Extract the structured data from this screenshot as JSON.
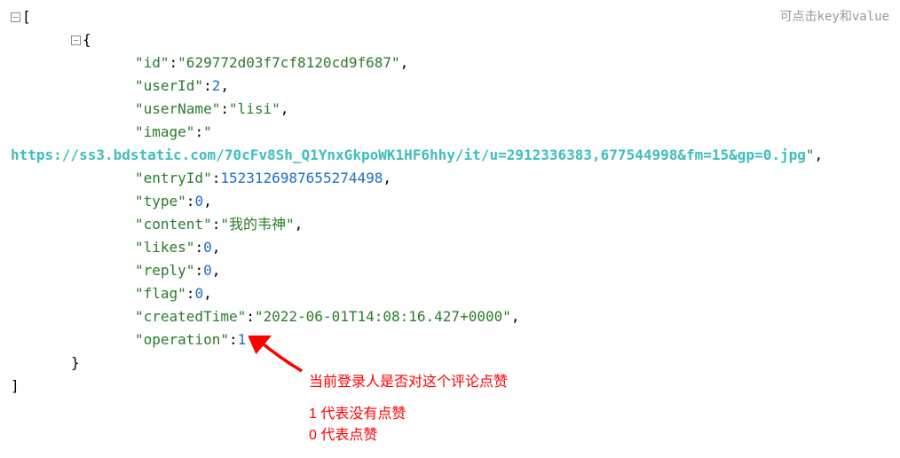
{
  "hint": "可点击key和value",
  "json": {
    "keys": {
      "id": "\"id\"",
      "userId": "\"userId\"",
      "userName": "\"userName\"",
      "image": "\"image\"",
      "entryId": "\"entryId\"",
      "type": "\"type\"",
      "content": "\"content\"",
      "likes": "\"likes\"",
      "reply": "\"reply\"",
      "flag": "\"flag\"",
      "createdTime": "\"createdTime\"",
      "operation": "\"operation\""
    },
    "values": {
      "id": "\"629772d03f7cf8120cd9f687\"",
      "userId": "2",
      "userName": "\"lisi\"",
      "image_prefixQuote": "\"",
      "image_url": "https://ss3.bdstatic.com/70cFv8Sh_Q1YnxGkpoWK1HF6hhy/it/u=2912336383,677544998&fm=15&gp=0.jpg",
      "image_suffixQuote": "\"",
      "entryId": "1523126987655274498",
      "type": "0",
      "content": "\"我的韦神\"",
      "likes": "0",
      "reply": "0",
      "flag": "0",
      "createdTime": "\"2022-06-01T14:08:16.427+0000\"",
      "operation": "1"
    },
    "punct": {
      "colon": ":",
      "comma": ",",
      "openBracket": "[",
      "closeBracket": "]",
      "openBrace": "{",
      "closeBrace": "}",
      "minus": "−"
    }
  },
  "notes": {
    "line1": "当前登录人是否对这个评论点赞",
    "line2": "1 代表没有点赞",
    "line3": "0 代表点赞"
  }
}
